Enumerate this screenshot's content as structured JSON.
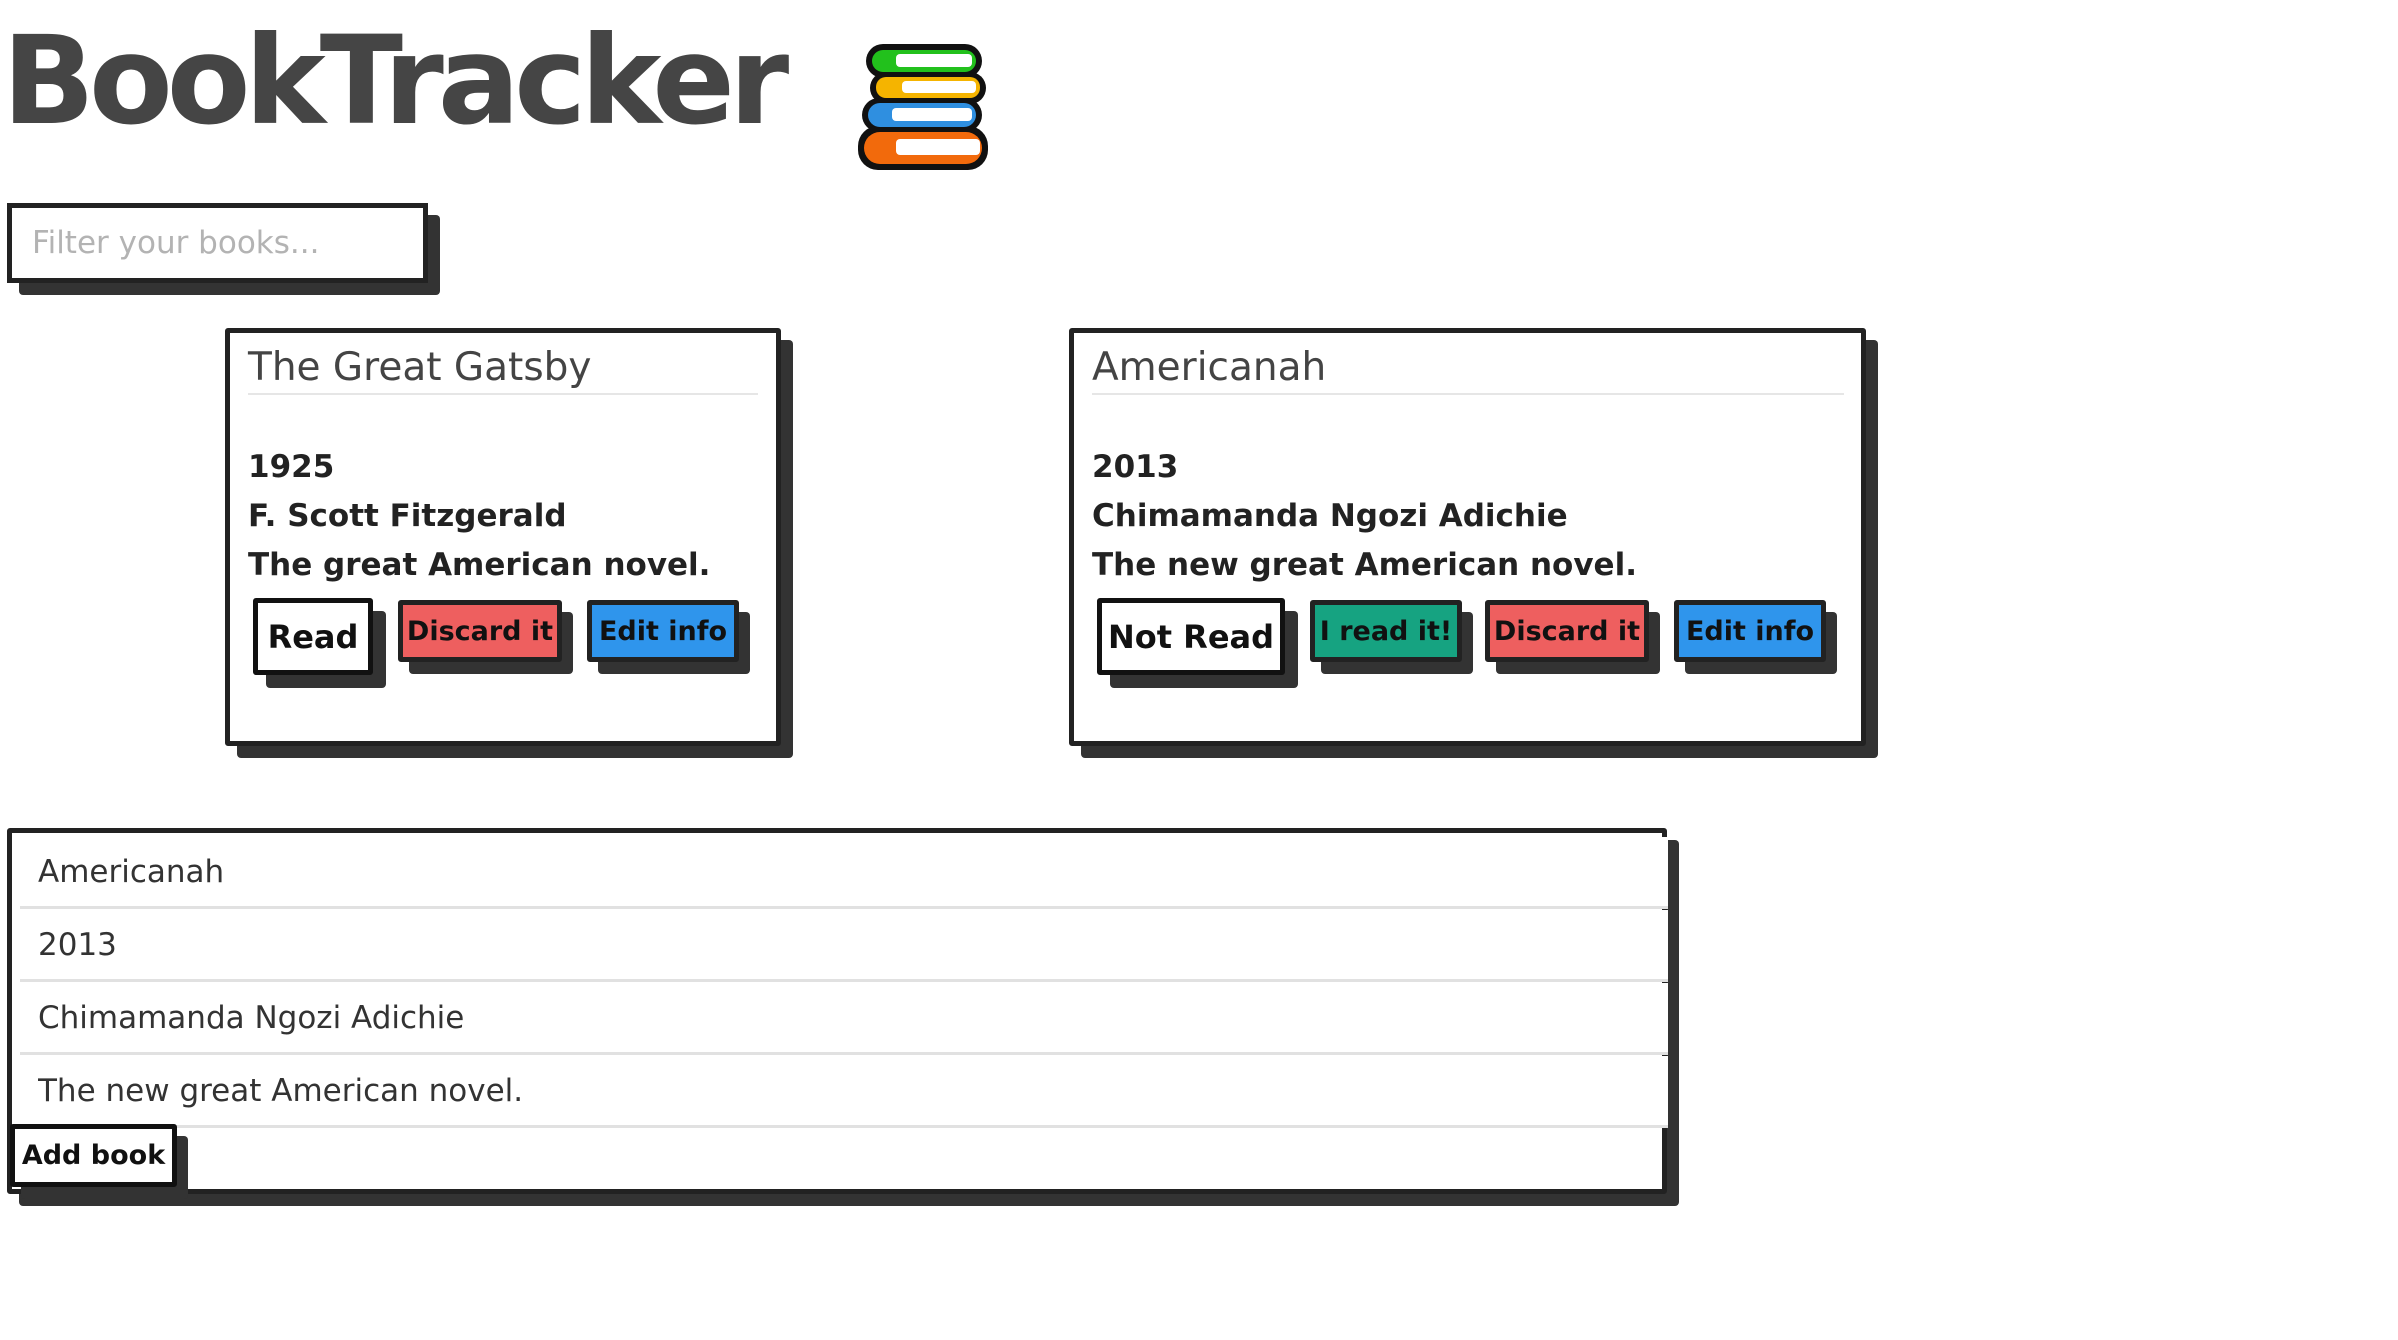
{
  "header": {
    "title": "BookTracker",
    "logo_icon": "stacked-books-icon"
  },
  "filter": {
    "placeholder": "Filter your books..."
  },
  "books": [
    {
      "title": "The Great Gatsby",
      "year": "1925",
      "author": "F. Scott Fitzgerald",
      "description": "The great American novel.",
      "status_button": "Read",
      "discard_button": "Discard it",
      "edit_button": "Edit info"
    },
    {
      "title": "Americanah",
      "year": "2013",
      "author": "Chimamanda Ngozi Adichie",
      "description": "The new great American novel.",
      "status_button": "Not Read",
      "read_button": "I read it!",
      "discard_button": "Discard it",
      "edit_button": "Edit info"
    }
  ],
  "add_form": {
    "title_value": "Americanah",
    "year_value": "2013",
    "author_value": "Chimamanda Ngozi Adichie",
    "description_value": "The new great American novel.",
    "submit_label": "Add book"
  },
  "colors": {
    "title_gray": "#454545",
    "border": "#222222",
    "discard_red": "#ee5f5f",
    "edit_blue": "#2f95ec",
    "read_green": "#16a381",
    "logo_green": "#22c11c",
    "logo_yellow": "#f5b400",
    "logo_blue": "#2f8fe0",
    "logo_orange": "#f26a0c"
  }
}
